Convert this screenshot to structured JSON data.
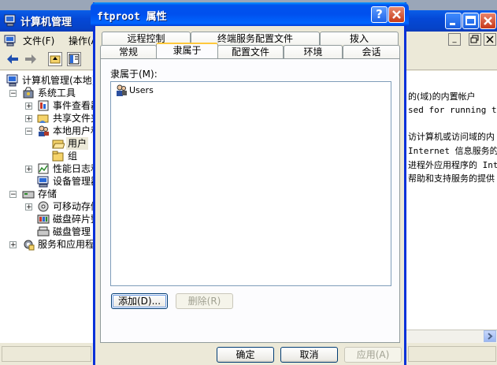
{
  "background_window": {
    "title": "计算机管理",
    "menu": [
      "文件(F)",
      "操作(A)"
    ],
    "tree": [
      {
        "label": "计算机管理(本地)",
        "level": 0
      },
      {
        "label": "系统工具",
        "level": 1
      },
      {
        "label": "事件查看器",
        "level": 2
      },
      {
        "label": "共享文件夹",
        "level": 2
      },
      {
        "label": "本地用户和组",
        "level": 2
      },
      {
        "label": "用户",
        "level": 3
      },
      {
        "label": "组",
        "level": 3
      },
      {
        "label": "性能日志和警报",
        "level": 2
      },
      {
        "label": "设备管理器",
        "level": 2
      },
      {
        "label": "存储",
        "level": 1
      },
      {
        "label": "可移动存储",
        "level": 2
      },
      {
        "label": "磁盘碎片整理程序",
        "level": 2
      },
      {
        "label": "磁盘管理",
        "level": 2
      },
      {
        "label": "服务和应用程序",
        "level": 1
      }
    ],
    "right_pane_lines": [
      "的(域)的内置帐户",
      "sed for running the",
      "",
      "访计算机或访问域的内",
      "Internet 信息服务的",
      "进程外应用程序的 Int",
      "帮助和支持服务的提供"
    ]
  },
  "dialog": {
    "title": "ftproot 属性",
    "help_label": "?",
    "tabs_back": [
      "远程控制",
      "终端服务配置文件",
      "拨入"
    ],
    "tabs_front": [
      "常规",
      "隶属于",
      "配置文件",
      "环境",
      "会话"
    ],
    "active_tab": "隶属于",
    "memberof_label": "隶属于(M):",
    "members": [
      "Users"
    ],
    "add_button": "添加(D)...",
    "remove_button": "删除(R)",
    "ok_button": "确定",
    "cancel_button": "取消",
    "apply_button": "应用(A)"
  },
  "colors": {
    "titlebar_blue": "#0053ee",
    "dialog_face": "#ece9d8",
    "active_tab_highlight": "#ffc83c"
  }
}
